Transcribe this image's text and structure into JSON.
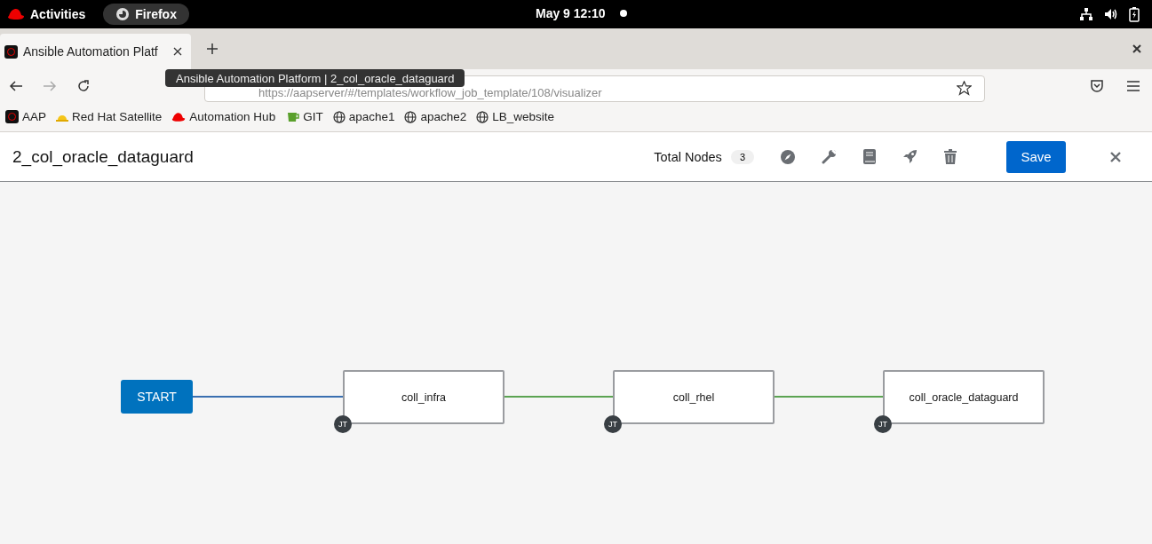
{
  "topbar": {
    "activities": "Activities",
    "app": "Firefox",
    "clock": "May 9  12:10"
  },
  "browser": {
    "tab": {
      "title": "Ansible Automation Platf",
      "selected": true
    },
    "tooltip": "Ansible Automation Platform | 2_col_oracle_dataguard",
    "url": "https://aapserver/#/templates/workflow_job_template/108/visualizer",
    "bookmarks": [
      {
        "label": "AAP",
        "kind": "aap"
      },
      {
        "label": "Red Hat Satellite",
        "kind": "helmet"
      },
      {
        "label": "Automation Hub",
        "kind": "hat"
      },
      {
        "label": "GIT",
        "kind": "git"
      },
      {
        "label": "apache1",
        "kind": "globe"
      },
      {
        "label": "apache2",
        "kind": "globe"
      },
      {
        "label": "LB_website",
        "kind": "globe"
      }
    ]
  },
  "header": {
    "title": "2_col_oracle_dataguard",
    "total_label": "Total Nodes",
    "total_count": "3",
    "save": "Save"
  },
  "workflow": {
    "start": "START",
    "nodes": [
      {
        "name": "coll_infra",
        "badge": "JT"
      },
      {
        "name": "coll_rhel",
        "badge": "JT"
      },
      {
        "name": "coll_oracle_dataguard",
        "badge": "JT"
      }
    ],
    "edges": [
      {
        "color": "#3a6fb0"
      },
      {
        "color": "#5ba352"
      },
      {
        "color": "#5ba352"
      }
    ]
  }
}
